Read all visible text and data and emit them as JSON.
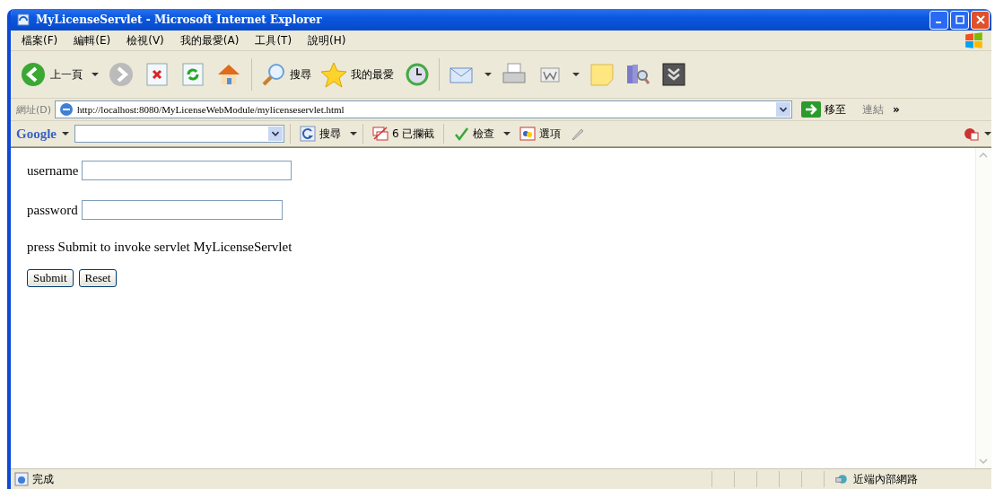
{
  "window": {
    "title": "MyLicenseServlet - Microsoft Internet Explorer"
  },
  "menu": [
    "檔案(F)",
    "編輯(E)",
    "檢視(V)",
    "我的最愛(A)",
    "工具(T)",
    "說明(H)"
  ],
  "toolbar": {
    "back": "上一頁",
    "search": "搜尋",
    "favorites": "我的最愛"
  },
  "address": {
    "label": "網址(D)",
    "url": "http://localhost:8080/MyLicenseWebModule/mylicenseservlet.html",
    "go": "移至",
    "links": "連結",
    "more": "»"
  },
  "google_bar": {
    "logo": "Google",
    "search": "搜尋",
    "blocked": "6 已攔截",
    "check": "檢查",
    "options": "選項"
  },
  "form": {
    "fields": [
      {
        "label": "username"
      },
      {
        "label": "password"
      }
    ],
    "note": "press Submit to invoke servlet MyLicenseServlet",
    "buttons": [
      "Submit",
      "Reset"
    ]
  },
  "status_bar": {
    "text": "完成",
    "zone": "近端內部網路"
  }
}
